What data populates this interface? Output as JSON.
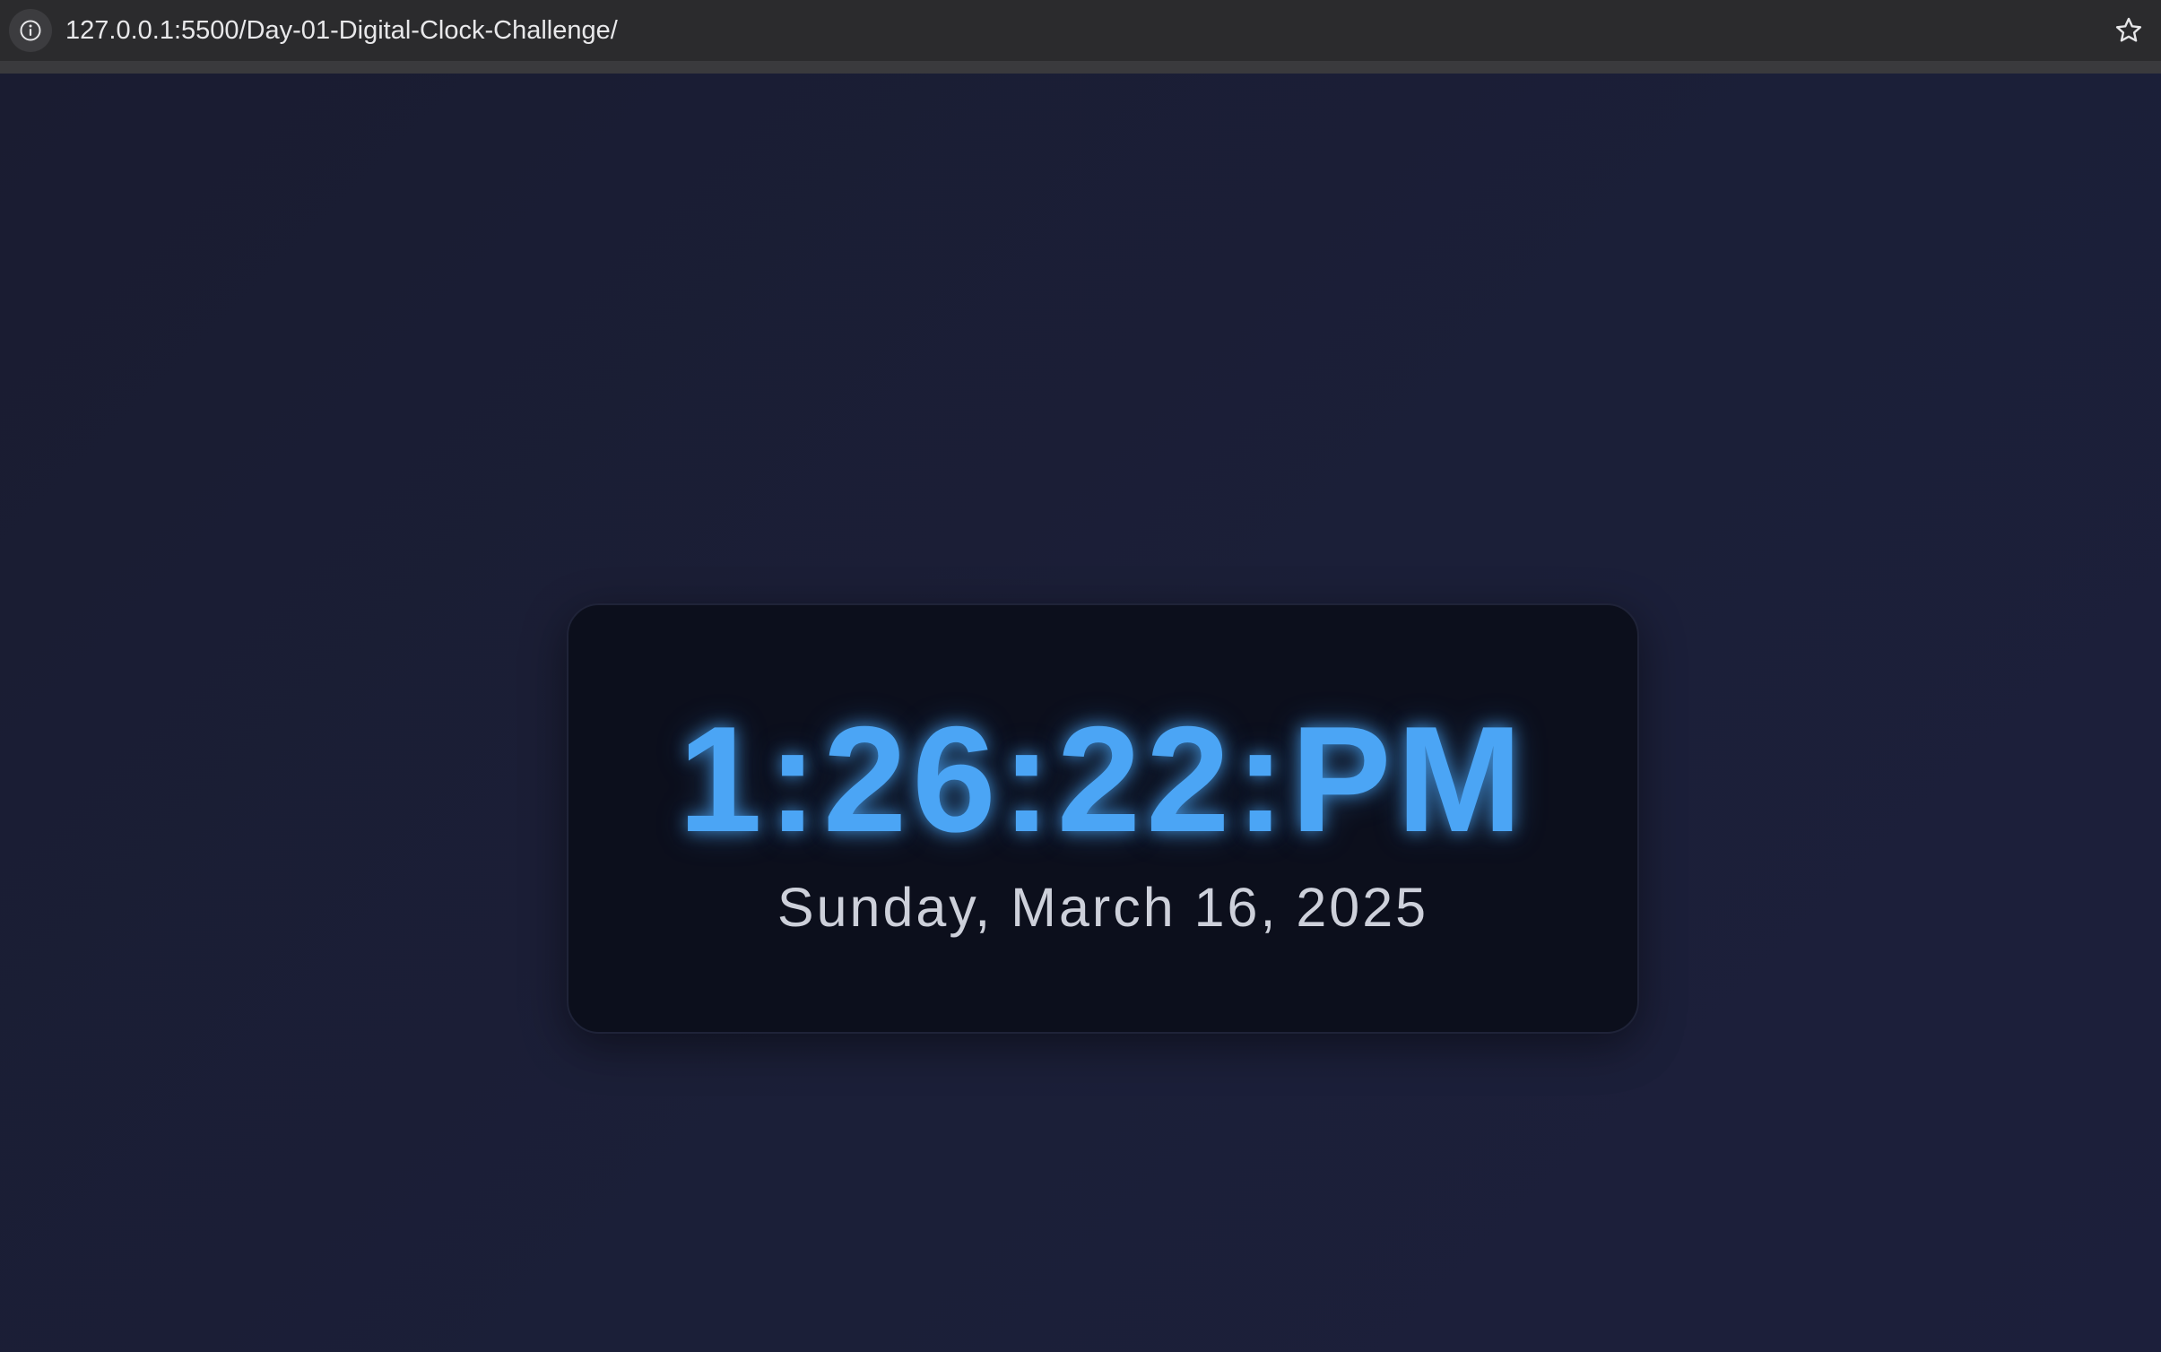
{
  "browser": {
    "url_host": "127.0.0.1",
    "url_path": ":5500/Day-01-Digital-Clock-Challenge/",
    "info_icon": "info-icon",
    "bookmark_icon": "star-icon"
  },
  "clock": {
    "time": "1:26:22:PM",
    "date": "Sunday, March 16, 2025"
  },
  "colors": {
    "background": "#1b1e35",
    "card": "#0c0f1c",
    "time": "#4ba5f5",
    "date": "#cdd0da"
  }
}
